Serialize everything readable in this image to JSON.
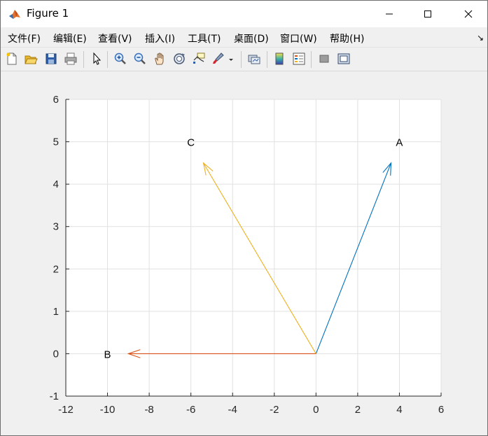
{
  "window": {
    "title": "Figure 1",
    "controls": [
      "minimize-icon",
      "maximize-icon",
      "close-icon"
    ]
  },
  "menu": {
    "items": [
      "文件(F)",
      "编辑(E)",
      "查看(V)",
      "插入(I)",
      "工具(T)",
      "桌面(D)",
      "窗口(W)",
      "帮助(H)"
    ],
    "dock_arrow": "↘"
  },
  "toolbar": {
    "icons": [
      "new-figure-icon",
      "open-file-icon",
      "save-icon",
      "print-icon",
      "select-pointer-icon",
      "zoom-in-icon",
      "zoom-out-icon",
      "pan-hand-icon",
      "rotate-3d-icon",
      "data-cursor-icon",
      "brush-icon",
      "brush-dropdown-icon",
      "link-plot-icon",
      "insert-colorbar-icon",
      "insert-legend-icon",
      "hide-plot-tools-icon",
      "show-plot-tools-icon"
    ]
  },
  "chart_data": {
    "type": "quiver",
    "title": "",
    "xlabel": "",
    "ylabel": "",
    "xlim": [
      -12,
      6
    ],
    "ylim": [
      -1,
      6
    ],
    "xticks": [
      -12,
      -10,
      -8,
      -6,
      -4,
      -2,
      0,
      2,
      4,
      6
    ],
    "yticks": [
      -1,
      0,
      1,
      2,
      3,
      4,
      5,
      6
    ],
    "grid": true,
    "vectors": [
      {
        "x0": 0,
        "y0": 0,
        "x1": 3.6,
        "y1": 4.5,
        "color": "#0072BD"
      },
      {
        "x0": 0,
        "y0": 0,
        "x1": -9,
        "y1": 0,
        "color": "#D95319"
      },
      {
        "x0": 0,
        "y0": 0,
        "x1": -5.4,
        "y1": 4.5,
        "color": "#EDB120"
      }
    ],
    "annotations": [
      {
        "text": "A",
        "x": 4,
        "y": 5
      },
      {
        "text": "B",
        "x": -10,
        "y": 0
      },
      {
        "text": "C",
        "x": -6,
        "y": 5
      }
    ]
  }
}
